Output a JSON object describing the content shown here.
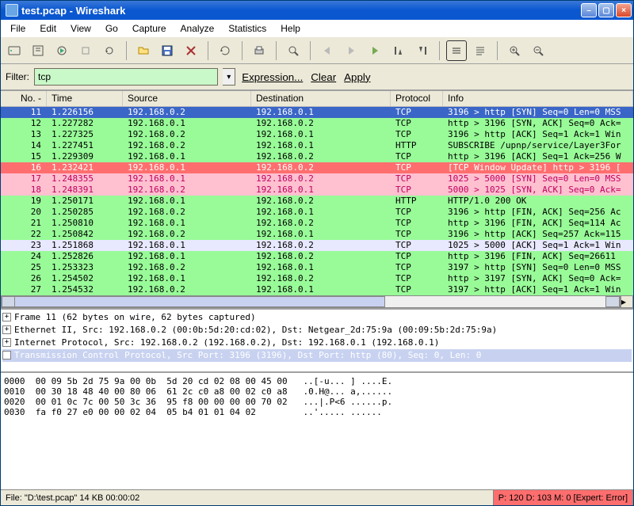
{
  "window": {
    "title": "test.pcap - Wireshark"
  },
  "menus": [
    "File",
    "Edit",
    "View",
    "Go",
    "Capture",
    "Analyze",
    "Statistics",
    "Help"
  ],
  "filter": {
    "label": "Filter:",
    "value": "tcp",
    "expression": "Expression...",
    "clear": "Clear",
    "apply": "Apply"
  },
  "columns": {
    "no": "No. -",
    "time": "Time",
    "source": "Source",
    "dest": "Destination",
    "protocol": "Protocol",
    "info": "Info"
  },
  "packets": [
    {
      "no": "11",
      "time": "1.226156",
      "src": "192.168.0.2",
      "dst": "192.168.0.1",
      "proto": "TCP",
      "info": "3196 > http  [SYN]  Seq=0 Len=0 MSS",
      "cls": "sel"
    },
    {
      "no": "12",
      "time": "1.227282",
      "src": "192.168.0.1",
      "dst": "192.168.0.2",
      "proto": "TCP",
      "info": "http > 3196 [SYN, ACK] Seq=0 Ack=",
      "cls": "green"
    },
    {
      "no": "13",
      "time": "1.227325",
      "src": "192.168.0.2",
      "dst": "192.168.0.1",
      "proto": "TCP",
      "info": "3196 > http [ACK] Seq=1 Ack=1 Win",
      "cls": "green"
    },
    {
      "no": "14",
      "time": "1.227451",
      "src": "192.168.0.2",
      "dst": "192.168.0.1",
      "proto": "HTTP",
      "info": "SUBSCRIBE /upnp/service/Layer3For",
      "cls": "green"
    },
    {
      "no": "15",
      "time": "1.229309",
      "src": "192.168.0.1",
      "dst": "192.168.0.2",
      "proto": "TCP",
      "info": "http > 3196 [ACK] Seq=1 Ack=256 W",
      "cls": "green"
    },
    {
      "no": "16",
      "time": "1.232421",
      "src": "192.168.0.1",
      "dst": "192.168.0.2",
      "proto": "TCP",
      "info": "[TCP Window Update] http > 3196 [",
      "cls": "red"
    },
    {
      "no": "17",
      "time": "1.248355",
      "src": "192.168.0.1",
      "dst": "192.168.0.2",
      "proto": "TCP",
      "info": "1025 > 5000 [SYN] Seq=0 Len=0 MSS",
      "cls": "pink"
    },
    {
      "no": "18",
      "time": "1.248391",
      "src": "192.168.0.2",
      "dst": "192.168.0.1",
      "proto": "TCP",
      "info": "5000 > 1025 [SYN, ACK] Seq=0 Ack=",
      "cls": "pink"
    },
    {
      "no": "19",
      "time": "1.250171",
      "src": "192.168.0.1",
      "dst": "192.168.0.2",
      "proto": "HTTP",
      "info": "HTTP/1.0 200 OK",
      "cls": "green"
    },
    {
      "no": "20",
      "time": "1.250285",
      "src": "192.168.0.2",
      "dst": "192.168.0.1",
      "proto": "TCP",
      "info": "3196 > http [FIN, ACK] Seq=256 Ac",
      "cls": "green"
    },
    {
      "no": "21",
      "time": "1.250810",
      "src": "192.168.0.1",
      "dst": "192.168.0.2",
      "proto": "TCP",
      "info": "http > 3196 [FIN, ACK] Seq=114 Ac",
      "cls": "green"
    },
    {
      "no": "22",
      "time": "1.250842",
      "src": "192.168.0.2",
      "dst": "192.168.0.1",
      "proto": "TCP",
      "info": "3196 > http [ACK] Seq=257 Ack=115",
      "cls": "green"
    },
    {
      "no": "23",
      "time": "1.251868",
      "src": "192.168.0.1",
      "dst": "192.168.0.2",
      "proto": "TCP",
      "info": "1025 > 5000 [ACK] Seq=1 Ack=1 Win",
      "cls": "lav"
    },
    {
      "no": "24",
      "time": "1.252826",
      "src": "192.168.0.1",
      "dst": "192.168.0.2",
      "proto": "TCP",
      "info": "http > 3196 [FIN, ACK] Seq=26611 ",
      "cls": "green"
    },
    {
      "no": "25",
      "time": "1.253323",
      "src": "192.168.0.2",
      "dst": "192.168.0.1",
      "proto": "TCP",
      "info": "3197 > http [SYN] Seq=0 Len=0 MSS",
      "cls": "green"
    },
    {
      "no": "26",
      "time": "1.254502",
      "src": "192.168.0.1",
      "dst": "192.168.0.2",
      "proto": "TCP",
      "info": "http > 3197 [SYN, ACK] Seq=0 Ack=",
      "cls": "green"
    },
    {
      "no": "27",
      "time": "1.254532",
      "src": "192.168.0.2",
      "dst": "192.168.0.1",
      "proto": "TCP",
      "info": "3197 > http [ACK] Seq=1 Ack=1 Win",
      "cls": "green"
    }
  ],
  "tree": {
    "frame": "Frame 11 (62 bytes on wire, 62 bytes captured)",
    "eth": "Ethernet II, Src: 192.168.0.2 (00:0b:5d:20:cd:02), Dst: Netgear_2d:75:9a (00:09:5b:2d:75:9a)",
    "ip": "Internet Protocol, Src: 192.168.0.2 (192.168.0.2), Dst: 192.168.0.1 (192.168.0.1)",
    "tcp": "Transmission Control Protocol, Src Port: 3196 (3196), Dst Port: http (80), Seq: 0, Len: 0"
  },
  "hex": {
    "l0": "0000  00 09 5b 2d 75 9a 00 0b  5d 20 cd 02 08 00 45 00   ..[-u... ] ....E.",
    "l1": "0010  00 30 18 48 40 00 80 06  61 2c c0 a8 00 02 c0 a8   .0.H@... a,......",
    "l2": "0020  00 01 0c 7c 00 50 3c 36  95 f8 00 00 00 00 70 02   ...|.P<6 ......p.",
    "l3": "0030  fa f0 27 e0 00 00 02 04  05 b4 01 01 04 02         ..'..... ......"
  },
  "status": {
    "file": "File: \"D:\\test.pcap\" 14 KB 00:00:02",
    "pkts": "P: 120 D: 103 M: 0 [Expert: Error]"
  },
  "icons": {
    "min": "–",
    "max": "▢",
    "close": "×",
    "dd": "▾",
    "plus": "+",
    "scroll_r": "▸"
  }
}
